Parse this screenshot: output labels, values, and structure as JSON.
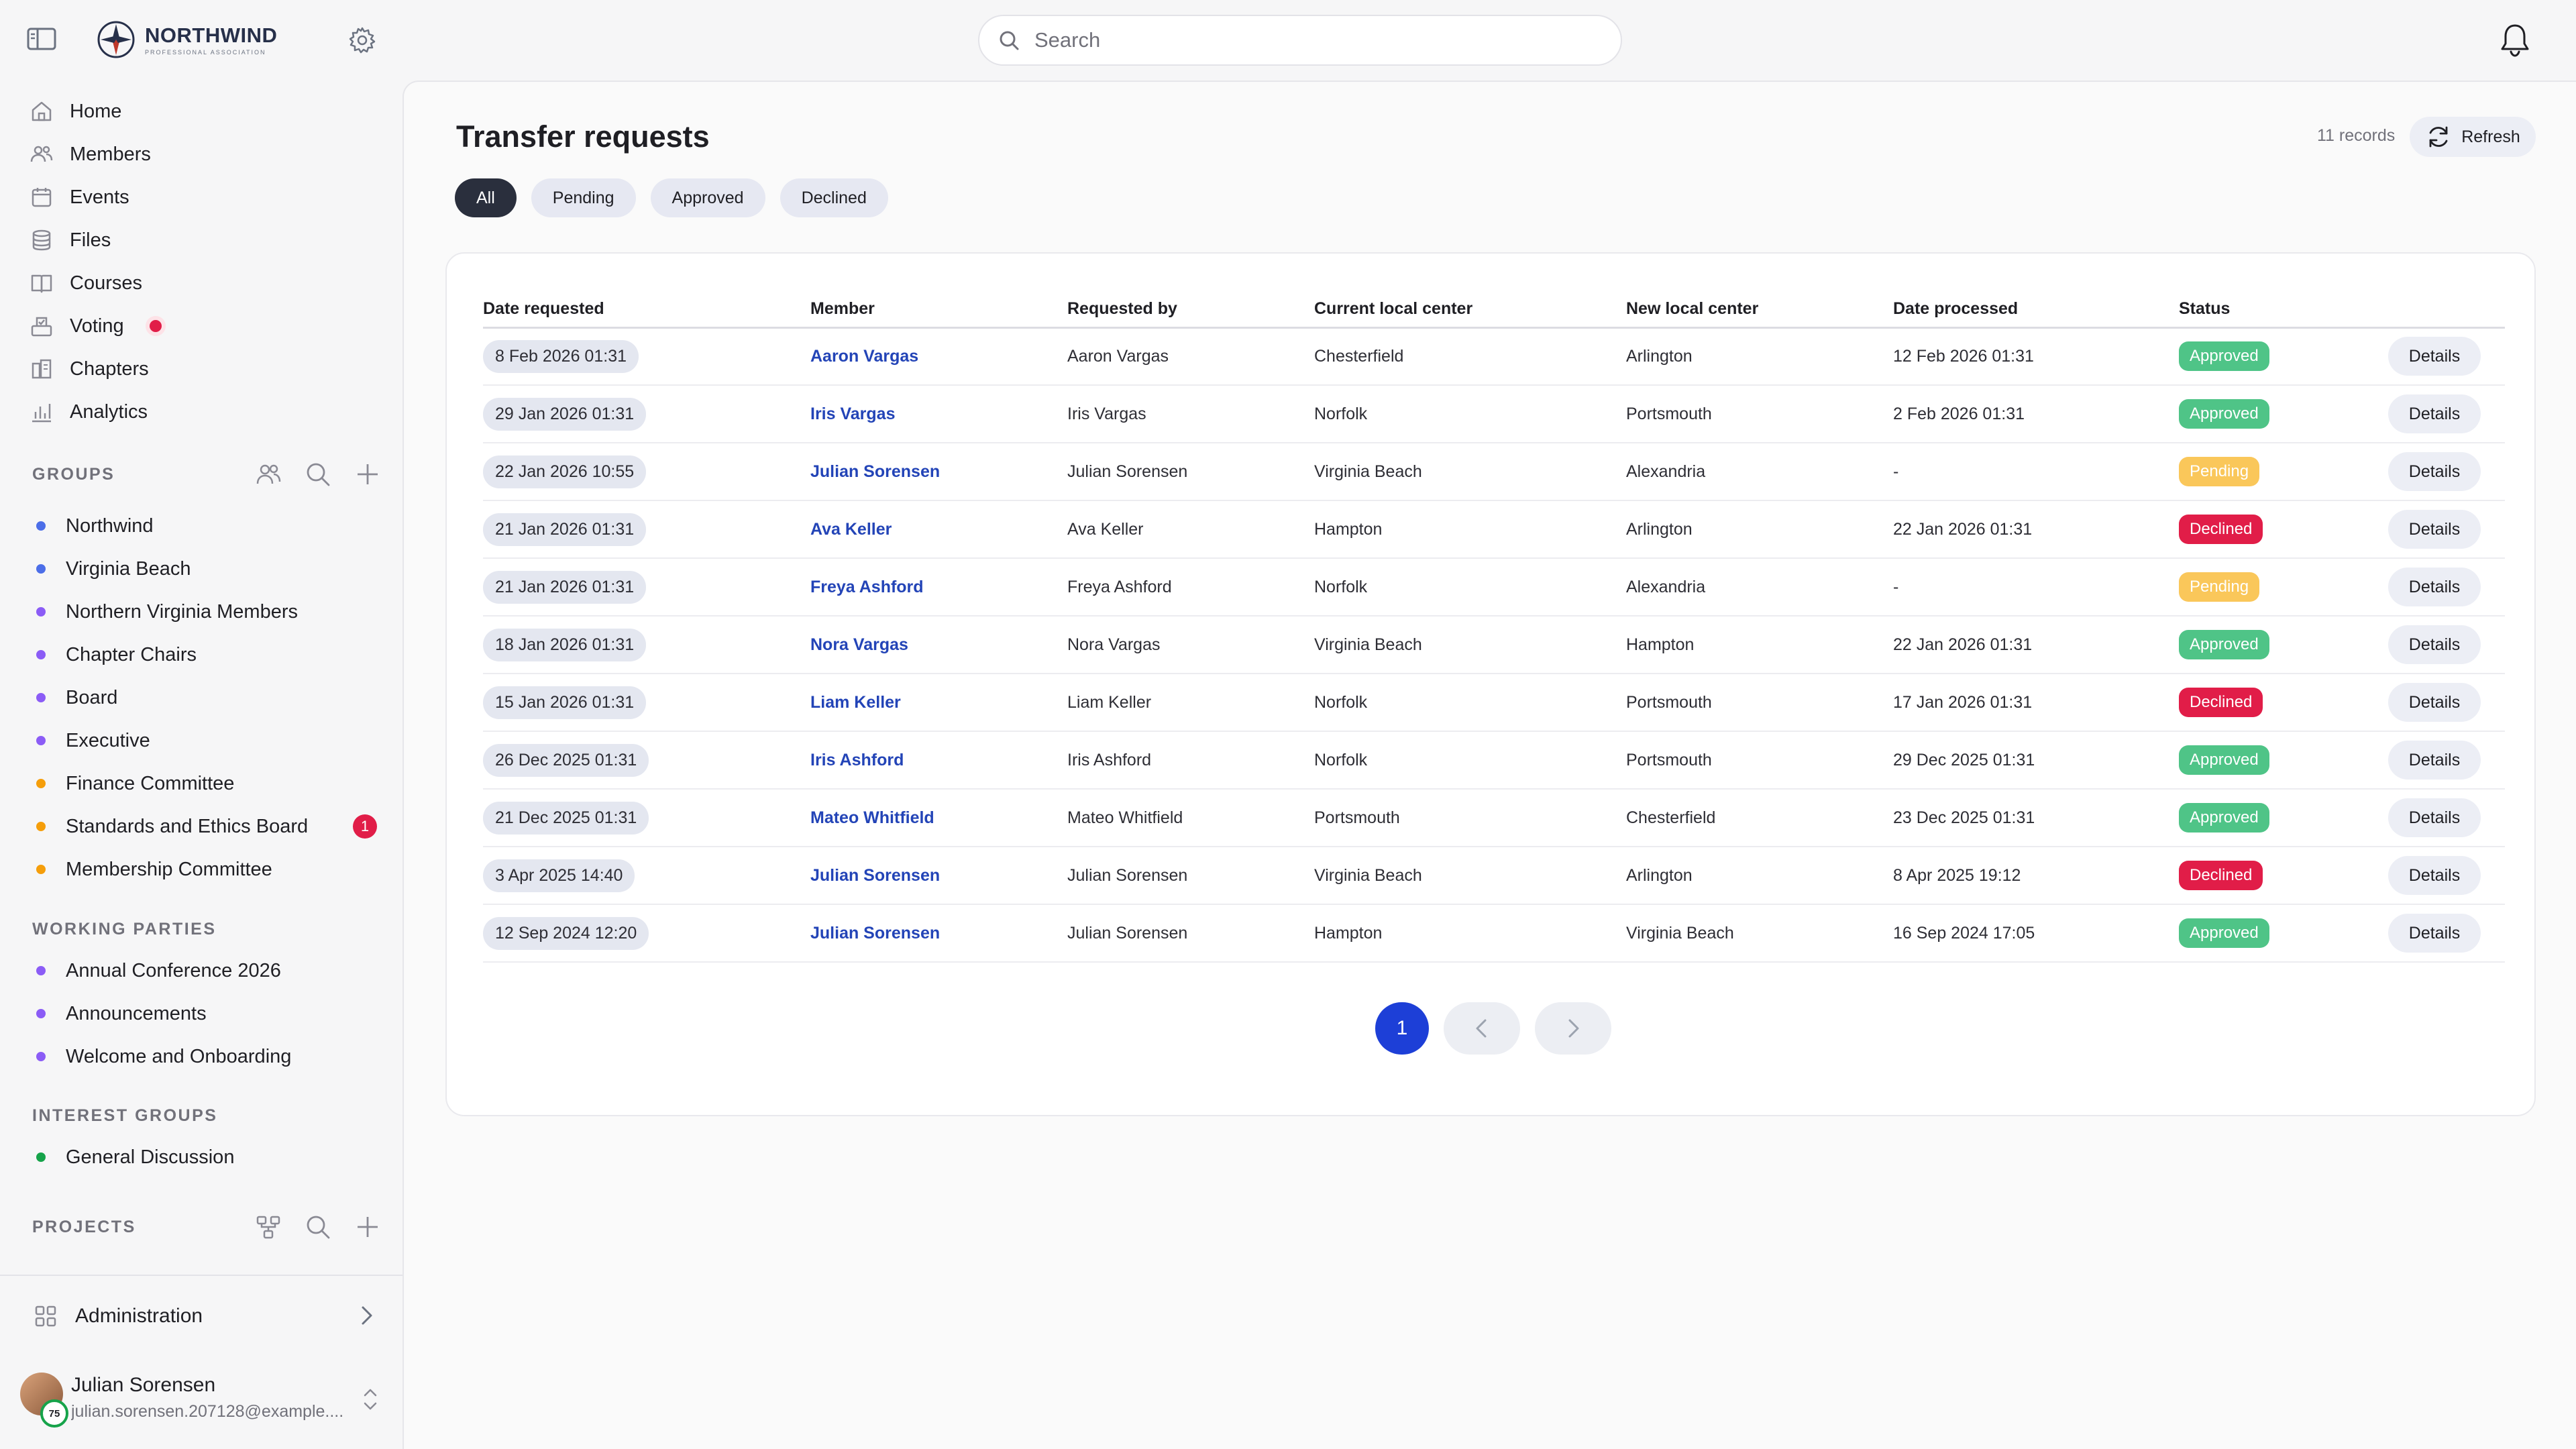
{
  "header": {
    "brand_name": "NORTHWIND",
    "brand_sub": "PROFESSIONAL ASSOCIATION",
    "search_placeholder": "Search"
  },
  "sidebar": {
    "nav": [
      {
        "label": "Home",
        "icon": "home-icon"
      },
      {
        "label": "Members",
        "icon": "members-icon"
      },
      {
        "label": "Events",
        "icon": "calendar-icon"
      },
      {
        "label": "Files",
        "icon": "files-icon"
      },
      {
        "label": "Courses",
        "icon": "book-icon"
      },
      {
        "label": "Voting",
        "icon": "voting-icon",
        "live": true
      },
      {
        "label": "Chapters",
        "icon": "chapters-icon"
      },
      {
        "label": "Analytics",
        "icon": "analytics-icon"
      }
    ],
    "groups_title": "GROUPS",
    "groups": [
      {
        "label": "Northwind",
        "color": "#4c6ee8"
      },
      {
        "label": "Virginia Beach",
        "color": "#4c6ee8"
      },
      {
        "label": "Northern Virginia Members",
        "color": "#8b5cf6"
      },
      {
        "label": "Chapter Chairs",
        "color": "#8b5cf6"
      },
      {
        "label": "Board",
        "color": "#8b5cf6"
      },
      {
        "label": "Executive",
        "color": "#8b5cf6"
      },
      {
        "label": "Finance Committee",
        "color": "#f59e0b"
      },
      {
        "label": "Standards and Ethics Board",
        "color": "#f59e0b",
        "badge": "1"
      },
      {
        "label": "Membership Committee",
        "color": "#f59e0b"
      }
    ],
    "working_parties_title": "WORKING PARTIES",
    "working_parties": [
      {
        "label": "Annual Conference 2026",
        "color": "#8b5cf6"
      },
      {
        "label": "Announcements",
        "color": "#8b5cf6"
      },
      {
        "label": "Welcome and Onboarding",
        "color": "#8b5cf6"
      }
    ],
    "interest_groups_title": "INTEREST GROUPS",
    "interest_groups": [
      {
        "label": "General Discussion",
        "color": "#16a34a"
      }
    ],
    "projects_title": "PROJECTS",
    "administration_label": "Administration",
    "user": {
      "name": "Julian Sorensen",
      "email": "julian.sorensen.207128@example....",
      "progress": "75"
    }
  },
  "main": {
    "title": "Transfer requests",
    "records_label": "11 records",
    "refresh_label": "Refresh",
    "filters": [
      "All",
      "Pending",
      "Approved",
      "Declined"
    ],
    "active_filter": "All",
    "columns": [
      "Date requested",
      "Member",
      "Requested by",
      "Current local center",
      "New local center",
      "Date processed",
      "Status",
      ""
    ],
    "details_label": "Details",
    "rows": [
      {
        "date": "8 Feb 2026 01:31",
        "member": "Aaron Vargas",
        "by": "Aaron Vargas",
        "current": "Chesterfield",
        "new": "Arlington",
        "processed": "12 Feb 2026 01:31",
        "status": "Approved"
      },
      {
        "date": "29 Jan 2026 01:31",
        "member": "Iris Vargas",
        "by": "Iris Vargas",
        "current": "Norfolk",
        "new": "Portsmouth",
        "processed": "2 Feb 2026 01:31",
        "status": "Approved"
      },
      {
        "date": "22 Jan 2026 10:55",
        "member": "Julian Sorensen",
        "by": "Julian Sorensen",
        "current": "Virginia Beach",
        "new": "Alexandria",
        "processed": "-",
        "status": "Pending"
      },
      {
        "date": "21 Jan 2026 01:31",
        "member": "Ava Keller",
        "by": "Ava Keller",
        "current": "Hampton",
        "new": "Arlington",
        "processed": "22 Jan 2026 01:31",
        "status": "Declined"
      },
      {
        "date": "21 Jan 2026 01:31",
        "member": "Freya Ashford",
        "by": "Freya Ashford",
        "current": "Norfolk",
        "new": "Alexandria",
        "processed": "-",
        "status": "Pending"
      },
      {
        "date": "18 Jan 2026 01:31",
        "member": "Nora Vargas",
        "by": "Nora Vargas",
        "current": "Virginia Beach",
        "new": "Hampton",
        "processed": "22 Jan 2026 01:31",
        "status": "Approved"
      },
      {
        "date": "15 Jan 2026 01:31",
        "member": "Liam Keller",
        "by": "Liam Keller",
        "current": "Norfolk",
        "new": "Portsmouth",
        "processed": "17 Jan 2026 01:31",
        "status": "Declined"
      },
      {
        "date": "26 Dec 2025 01:31",
        "member": "Iris Ashford",
        "by": "Iris Ashford",
        "current": "Norfolk",
        "new": "Portsmouth",
        "processed": "29 Dec 2025 01:31",
        "status": "Approved"
      },
      {
        "date": "21 Dec 2025 01:31",
        "member": "Mateo Whitfield",
        "by": "Mateo Whitfield",
        "current": "Portsmouth",
        "new": "Chesterfield",
        "processed": "23 Dec 2025 01:31",
        "status": "Approved"
      },
      {
        "date": "3 Apr 2025 14:40",
        "member": "Julian Sorensen",
        "by": "Julian Sorensen",
        "current": "Virginia Beach",
        "new": "Arlington",
        "processed": "8 Apr 2025 19:12",
        "status": "Declined"
      },
      {
        "date": "12 Sep 2024 12:20",
        "member": "Julian Sorensen",
        "by": "Julian Sorensen",
        "current": "Hampton",
        "new": "Virginia Beach",
        "processed": "16 Sep 2024 17:05",
        "status": "Approved"
      }
    ],
    "pagination": {
      "current_page": "1"
    }
  },
  "colors": {
    "accent": "#1d3fd7",
    "approved": "#4fc487",
    "pending": "#fac75a",
    "declined": "#e11d48",
    "link": "#2344b7"
  }
}
